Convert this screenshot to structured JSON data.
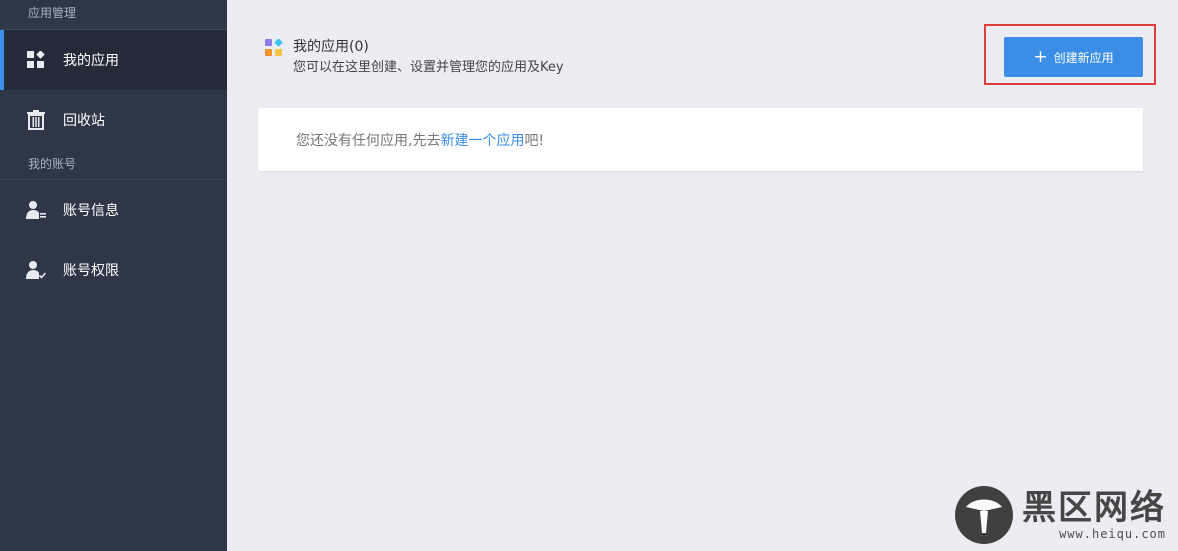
{
  "sidebar": {
    "section_apps": "应用管理",
    "items_apps": [
      {
        "label": "我的应用",
        "icon": "apps-grid-icon"
      },
      {
        "label": "回收站",
        "icon": "trash-icon"
      }
    ],
    "section_account": "我的账号",
    "items_account": [
      {
        "label": "账号信息",
        "icon": "user-info-icon"
      },
      {
        "label": "账号权限",
        "icon": "user-check-icon"
      }
    ]
  },
  "header": {
    "title": "我的应用(0)",
    "subtitle": "您可以在这里创建、设置并管理您的应用及Key"
  },
  "create_button": {
    "plus": "+",
    "label": "创建新应用"
  },
  "empty_state": {
    "prefix": "您还没有任何应用,先去",
    "link": "新建一个应用",
    "suffix": "吧!"
  },
  "watermark": {
    "name": "黑区网络",
    "url": "www.heiqu.com"
  },
  "colors": {
    "accent": "#3a8ee6",
    "sidebar_bg": "#2d3748",
    "highlight_border": "#e03c3c"
  }
}
